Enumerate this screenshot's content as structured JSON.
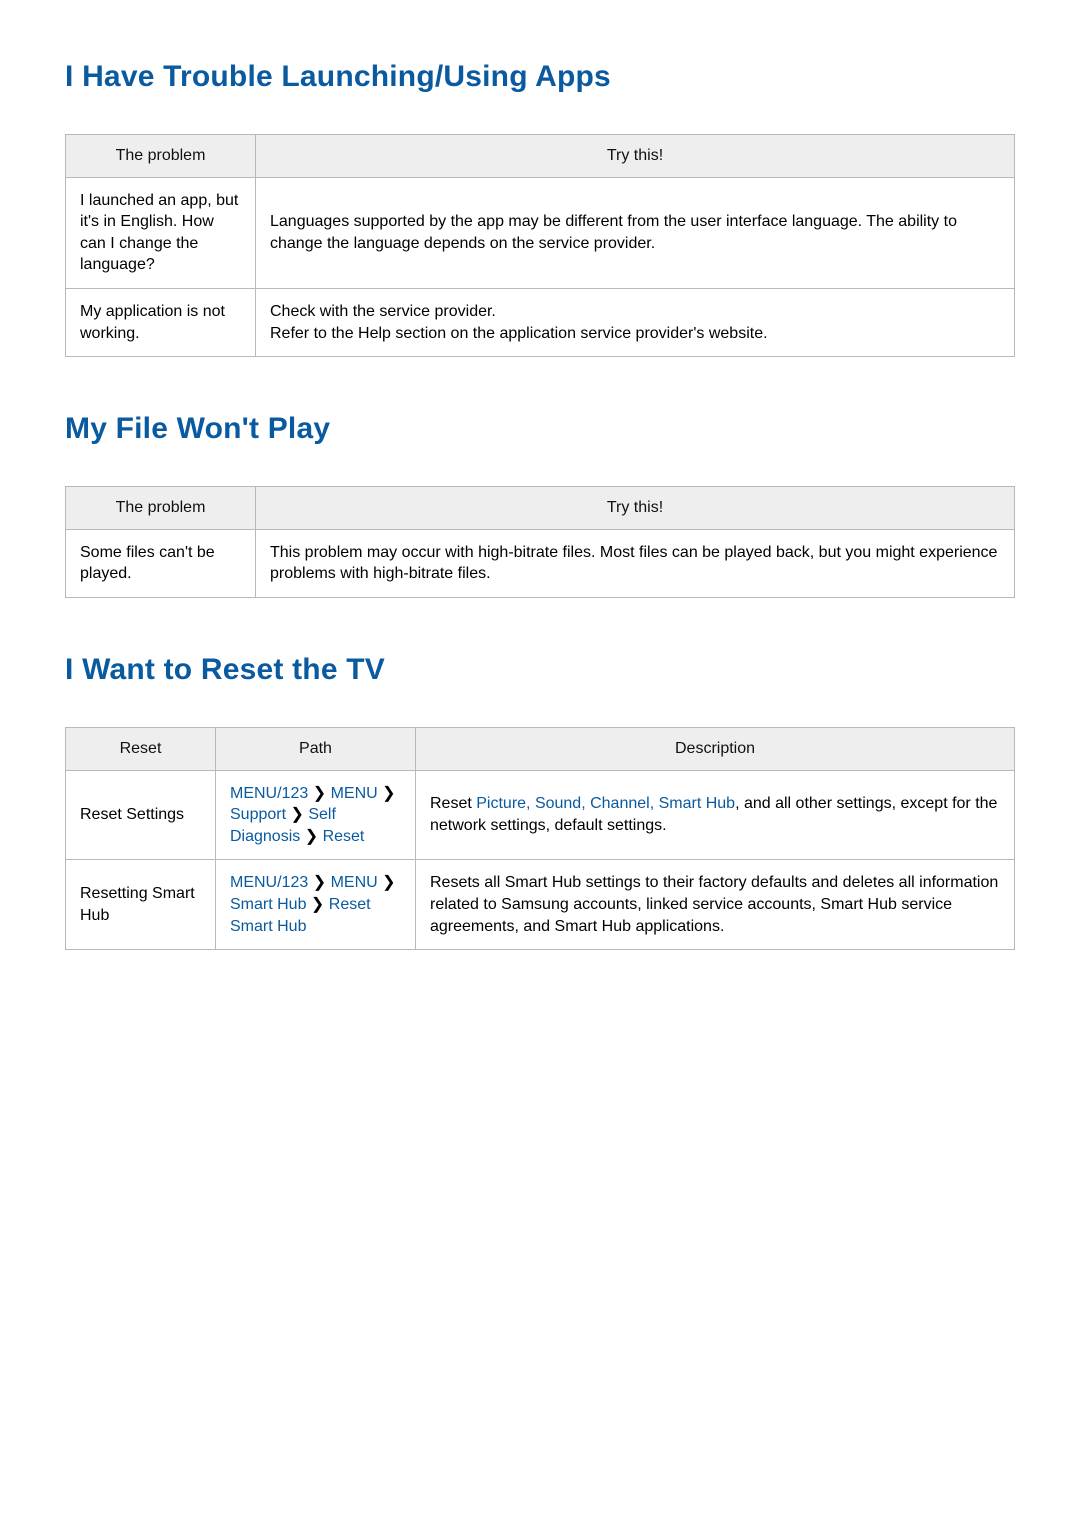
{
  "sections": {
    "apps": {
      "title": "I Have Trouble Launching/Using Apps",
      "headers": {
        "problem": "The problem",
        "try": "Try this!"
      },
      "rows": [
        {
          "problem": "I launched an app, but it's in English. How can I change the language?",
          "try": "Languages supported by the app may be different from the user interface language. The ability to change the language depends on the service provider."
        },
        {
          "problem": "My application is not working.",
          "try": "Check with the service provider.\nRefer to the Help section on the application service provider's website."
        }
      ]
    },
    "file": {
      "title": "My File Won't Play",
      "headers": {
        "problem": "The problem",
        "try": "Try this!"
      },
      "rows": [
        {
          "problem": "Some files can't be played.",
          "try": "This problem may occur with high-bitrate files. Most files can be played back, but you might experience problems with high-bitrate files."
        }
      ]
    },
    "reset": {
      "title": "I Want to Reset the TV",
      "headers": {
        "reset": "Reset",
        "path": "Path",
        "desc": "Description"
      },
      "rows": [
        {
          "reset": "Reset Settings",
          "path_segments": [
            "MENU/123",
            "MENU",
            "Support",
            "Self Diagnosis",
            "Reset"
          ],
          "desc_pre": "Reset ",
          "desc_hl": "Picture, Sound, Channel, Smart Hub",
          "desc_post": ", and all other settings, except for the network settings, default settings."
        },
        {
          "reset": "Resetting Smart Hub",
          "path_segments": [
            "MENU/123",
            "MENU",
            "Smart Hub",
            "Reset Smart Hub"
          ],
          "desc_plain": "Resets all Smart Hub settings to their factory defaults and deletes all information related to Samsung accounts, linked service accounts, Smart Hub service agreements, and Smart Hub applications."
        }
      ]
    }
  },
  "glyphs": {
    "chevron": "❯"
  }
}
